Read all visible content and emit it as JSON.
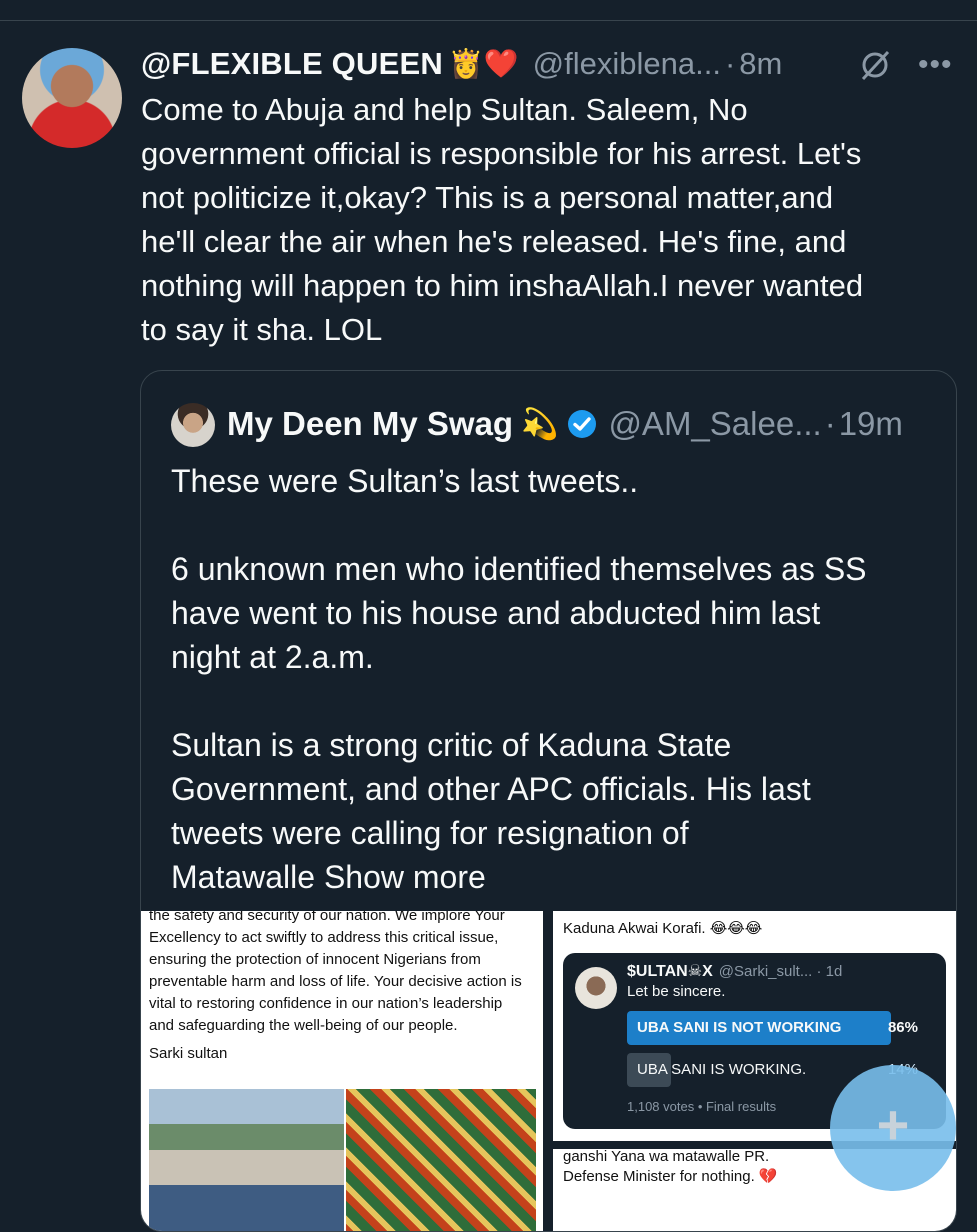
{
  "tweet": {
    "display_name": "@FLEXIBLE QUEEN",
    "emoji": "👸❤️",
    "handle": "@flexiblena...",
    "separator": "·",
    "time": "8m",
    "more_label": "•••",
    "text": "Come to Abuja and help Sultan. Saleem, No\ngovernment official is responsible for his arrest. Let's\nnot politicize it,okay? This is a personal matter,and\nhe'll clear the air when he's released. He's fine, and\nnothing will happen to him inshaAllah.I never wanted\nto say it sha. LOL"
  },
  "quote": {
    "display_name": "My Deen My Swag",
    "emoji": "💫",
    "handle": "@AM_Salee...",
    "separator": "·",
    "time": "19m",
    "text": "These were Sultan’s last tweets..\n\n6 unknown men who identified themselves as SS\nhave went to his house and abducted him last\nnight at 2.a.m.\n\nSultan is a strong critic of Kaduna State\nGovernment, and other APC officials. His last\ntweets were calling for resignation of\nMatawalle ",
    "show_more": "Show more",
    "media": {
      "image1_text": "the safety and security of our nation. We implore Your\nExcellency to act swiftly to address this critical issue,\nensuring the protection of innocent Nigerians from\npreventable harm and loss of life. Your decisive action is\nvital to restoring confidence in our nation’s leadership\nand safeguarding the well-being of our people.",
      "image1_signature": "Sarki sultan",
      "image2_caption": "Kaduna Akwai Korafi. 😂😂😂",
      "poll_name": "$ULTAN☠X",
      "poll_handle": "@Sarki_sult... · 1d",
      "poll_label": "Let be sincere.",
      "poll_option1": "UBA SANI IS NOT WORKING",
      "poll_pct1": "86%",
      "poll_option2": "UBA SANI IS WORKING.",
      "poll_pct2": "14%",
      "poll_votes": "1,108 votes • Final results",
      "image3_text": "ganshi Yana wa matawalle PR.\nDefense Minister for nothing. 💔"
    }
  },
  "fab_label": "+"
}
